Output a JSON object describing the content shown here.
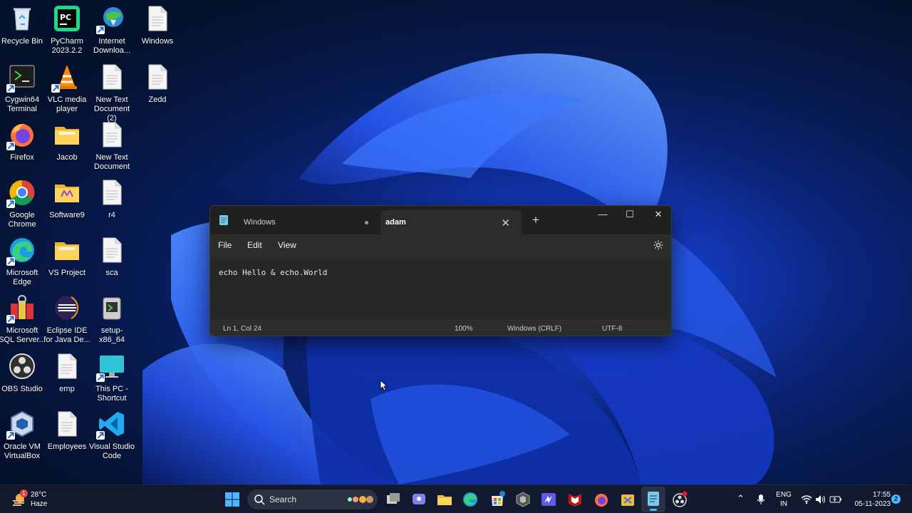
{
  "desktop": {
    "icons": [
      {
        "label": "Recycle Bin",
        "icon": "recycle-bin-icon"
      },
      {
        "label": "PyCharm 2023.2.2",
        "icon": "pycharm-icon"
      },
      {
        "label": "Internet Downloa...",
        "icon": "internet-download-manager-icon"
      },
      {
        "label": "Windows",
        "icon": "text-file-icon"
      },
      {
        "label": "Cygwin64 Terminal",
        "icon": "cygwin-terminal-icon"
      },
      {
        "label": "VLC media player",
        "icon": "vlc-icon"
      },
      {
        "label": "New Text Document (2)",
        "icon": "text-file-icon"
      },
      {
        "label": "Zedd",
        "icon": "text-file-icon"
      },
      {
        "label": "Firefox",
        "icon": "firefox-icon"
      },
      {
        "label": "Jacob",
        "icon": "folder-icon"
      },
      {
        "label": "New Text Document",
        "icon": "text-file-icon"
      },
      {
        "label": "Google Chrome",
        "icon": "chrome-icon"
      },
      {
        "label": "Software9",
        "icon": "folder-icon"
      },
      {
        "label": "r4",
        "icon": "text-file-icon"
      },
      {
        "label": "Microsoft Edge",
        "icon": "edge-icon"
      },
      {
        "label": "VS Project",
        "icon": "folder-icon"
      },
      {
        "label": "sca",
        "icon": "text-file-icon"
      },
      {
        "label": "Microsoft SQL Server...",
        "icon": "sql-server-icon"
      },
      {
        "label": "Eclipse IDE for Java De...",
        "icon": "eclipse-icon"
      },
      {
        "label": "setup-x86_64",
        "icon": "installer-icon"
      },
      {
        "label": "OBS Studio",
        "icon": "obs-icon"
      },
      {
        "label": "emp",
        "icon": "text-file-icon"
      },
      {
        "label": "This PC - Shortcut",
        "icon": "monitor-icon"
      },
      {
        "label": "Oracle VM VirtualBox",
        "icon": "virtualbox-icon"
      },
      {
        "label": "Employees",
        "icon": "text-file-icon"
      },
      {
        "label": "Visual Studio Code",
        "icon": "vscode-icon"
      }
    ]
  },
  "notepad": {
    "tabs": [
      {
        "label": "Windows",
        "modified": true
      },
      {
        "label": "adam",
        "active": true
      }
    ],
    "new_tab": "+",
    "controls": {
      "minimize": "—",
      "maximize": "☐",
      "close": "✕"
    },
    "menu": [
      "File",
      "Edit",
      "View"
    ],
    "content": "echo Hello & echo.World",
    "status": {
      "position": "Ln 1, Col 24",
      "zoom": "100%",
      "line_ending": "Windows (CRLF)",
      "encoding": "UTF-8"
    }
  },
  "taskbar": {
    "weather": {
      "temp": "28°C",
      "condition": "Haze",
      "badge": "1"
    },
    "search_label": "Search",
    "language": {
      "lang": "ENG",
      "region": "IN"
    },
    "clock": {
      "time": "17:55",
      "date": "05-11-2023"
    },
    "notification_count": "2"
  },
  "colors": {
    "accent_blue": "#1d4fe0",
    "notepad_bg": "#272727",
    "taskbar_bg": "#141a2c"
  }
}
